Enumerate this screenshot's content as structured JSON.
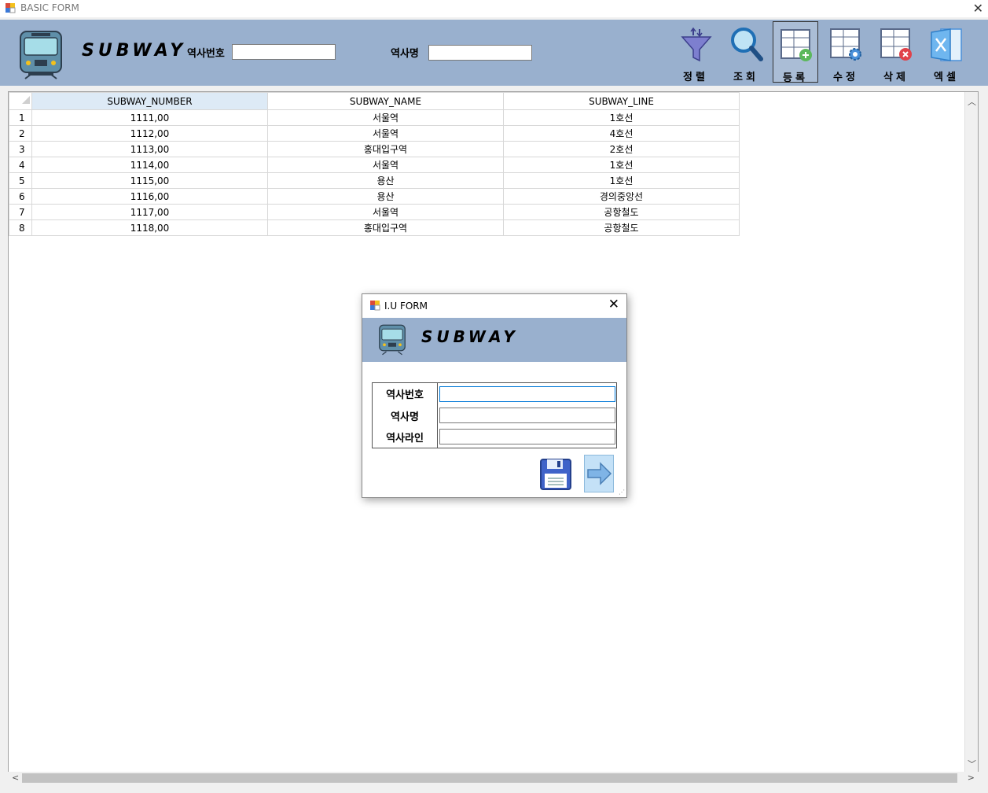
{
  "window": {
    "title": "BASIC FORM",
    "close_glyph": "✕"
  },
  "header": {
    "brand": "SUBWAY",
    "station_number_label": "역사번호",
    "station_number_value": "",
    "station_name_label": "역사명",
    "station_name_value": ""
  },
  "toolbar": [
    {
      "label": "정렬",
      "icon": "filter-icon"
    },
    {
      "label": "조회",
      "icon": "search-icon"
    },
    {
      "label": "등록",
      "icon": "add-grid-icon",
      "active": true
    },
    {
      "label": "수정",
      "icon": "edit-grid-icon"
    },
    {
      "label": "삭제",
      "icon": "delete-grid-icon"
    },
    {
      "label": "엑셀",
      "icon": "excel-icon"
    }
  ],
  "grid": {
    "columns": [
      "SUBWAY_NUMBER",
      "SUBWAY_NAME",
      "SUBWAY_LINE"
    ],
    "rows": [
      {
        "n": "1",
        "number": "1111,00",
        "name": "서울역",
        "line": "1호선"
      },
      {
        "n": "2",
        "number": "1112,00",
        "name": "서울역",
        "line": "4호선"
      },
      {
        "n": "3",
        "number": "1113,00",
        "name": "홍대입구역",
        "line": "2호선"
      },
      {
        "n": "4",
        "number": "1114,00",
        "name": "서울역",
        "line": "1호선"
      },
      {
        "n": "5",
        "number": "1115,00",
        "name": "용산",
        "line": "1호선"
      },
      {
        "n": "6",
        "number": "1116,00",
        "name": "용산",
        "line": "경의중앙선"
      },
      {
        "n": "7",
        "number": "1117,00",
        "name": "서울역",
        "line": "공항철도"
      },
      {
        "n": "8",
        "number": "1118,00",
        "name": "홍대입구역",
        "line": "공항철도"
      }
    ]
  },
  "dialog": {
    "title": "I.U FORM",
    "brand": "SUBWAY",
    "fields": [
      {
        "label": "역사번호",
        "value": ""
      },
      {
        "label": "역사명",
        "value": ""
      },
      {
        "label": "역사라인",
        "value": ""
      }
    ]
  },
  "colors": {
    "header_bg": "#99b0ce",
    "selected_header": "#ddeaf6"
  }
}
